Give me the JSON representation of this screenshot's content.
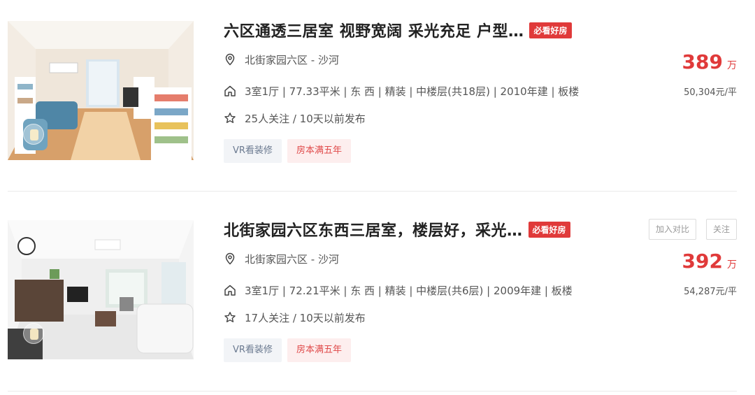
{
  "listings": [
    {
      "title": "六区通透三居室 视野宽阔 采光充足 户型…",
      "badge": "必看好房",
      "location": "北街家园六区 - 沙河",
      "house_info": "3室1厅 | 77.33平米 | 东 西 | 精装 | 中楼层(共18层) | 2010年建 | 板楼",
      "follow_info": "25人关注 / 10天以前发布",
      "tags": [
        "VR看装修",
        "房本满五年"
      ],
      "price": "389",
      "price_unit": "万",
      "unit_price": "50,304元/平",
      "buttons": []
    },
    {
      "title": "北街家园六区东西三居室，楼层好，采光…",
      "badge": "必看好房",
      "location": "北街家园六区 - 沙河",
      "house_info": "3室1厅 | 72.21平米 | 东 西 | 精装 | 中楼层(共6层) | 2009年建 | 板楼",
      "follow_info": "17人关注 / 10天以前发布",
      "tags": [
        "VR看装修",
        "房本满五年"
      ],
      "price": "392",
      "price_unit": "万",
      "unit_price": "54,287元/平",
      "buttons": [
        "加入对比",
        "关注"
      ]
    }
  ],
  "icons": {
    "location": "location-pin-icon",
    "house": "house-icon",
    "follow": "star-icon"
  },
  "colors": {
    "accent_red": "#e03a3a",
    "tag_vr_bg": "#f2f4f7",
    "tag_five_bg": "#fdeeee"
  }
}
